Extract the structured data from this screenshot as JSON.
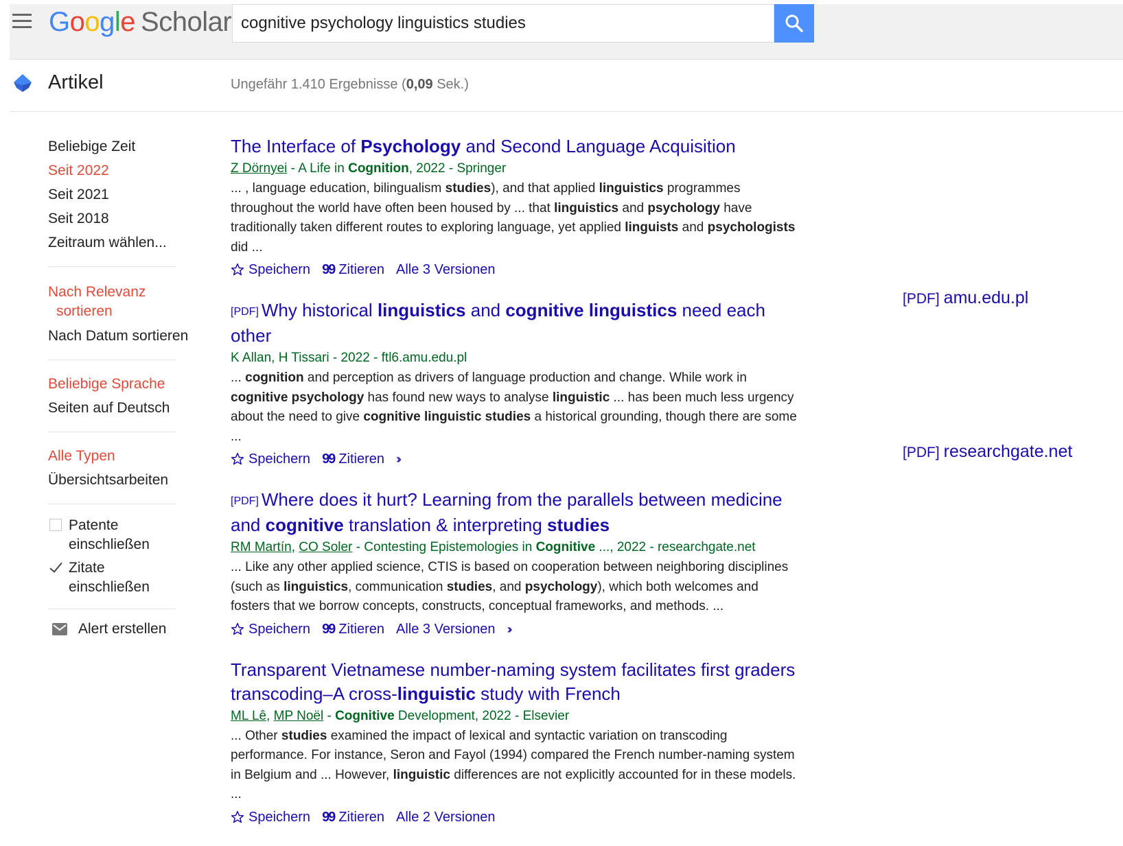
{
  "header": {
    "logo_google": [
      "G",
      "o",
      "o",
      "g",
      "l",
      "e"
    ],
    "logo_scholar": "Scholar",
    "search_value": "cognitive psychology linguistics studies"
  },
  "subbar": {
    "section_label": "Artikel",
    "stats_prefix": "Ungefähr 1.410 Ergebnisse (",
    "stats_time": "0,09",
    "stats_suffix": " Sek.)"
  },
  "sidebar": {
    "time": [
      "Beliebige Zeit",
      "Seit 2022",
      "Seit 2021",
      "Seit 2018",
      "Zeitraum wählen..."
    ],
    "sort_relevance_1": "Nach Relevanz",
    "sort_relevance_2": "sortieren",
    "sort_date": "Nach Datum sortieren",
    "lang_any": "Beliebige Sprache",
    "lang_de": "Seiten auf Deutsch",
    "type_all": "Alle Typen",
    "type_review": "Übersichtsarbeiten",
    "patents_1": "Patente",
    "patents_2": "einschließen",
    "citations": "Zitate einschließen",
    "alert": "Alert erstellen"
  },
  "actions": {
    "save": "Speichern",
    "cite": "Zitieren"
  },
  "results": [
    {
      "title": [
        {
          "t": "The Interface of "
        },
        {
          "b": "Psychology"
        },
        {
          "t": " and Second Language Acquisition"
        }
      ],
      "meta": [
        {
          "u": "Z Dörnyei"
        },
        {
          "t": " - A Life in "
        },
        {
          "b": "Cognition"
        },
        {
          "t": ", 2022 - Springer"
        }
      ],
      "snippet": [
        {
          "t": "... , language education, bilingualism "
        },
        {
          "b": "studies"
        },
        {
          "t": "), and that applied "
        },
        {
          "b": "linguistics"
        },
        {
          "t": " programmes throughout the world have often been housed by ... that "
        },
        {
          "b": "linguistics"
        },
        {
          "t": " and "
        },
        {
          "b": "psychology"
        },
        {
          "t": " have traditionally taken different routes to exploring language, yet applied "
        },
        {
          "b": "linguists"
        },
        {
          "t": " and "
        },
        {
          "b": "psychologists"
        },
        {
          "t": " did ..."
        }
      ],
      "versions": "Alle 3 Versionen",
      "more": false
    },
    {
      "tag": "[PDF]",
      "title": [
        {
          "t": "Why historical "
        },
        {
          "b": "linguistics"
        },
        {
          "t": " and "
        },
        {
          "b": "cognitive linguistics"
        },
        {
          "t": " need each other"
        }
      ],
      "meta": [
        {
          "t": "K Allan, H Tissari - 2022 - ftl6.amu.edu.pl"
        }
      ],
      "snippet": [
        {
          "t": "... "
        },
        {
          "b": "cognition"
        },
        {
          "t": " and perception as drivers of language production and change. While work in "
        },
        {
          "b": "cognitive psychology"
        },
        {
          "t": " has found new ways to analyse "
        },
        {
          "b": "linguistic"
        },
        {
          "t": " ... has been much less urgency about the need to give "
        },
        {
          "b": "cognitive linguistic studies"
        },
        {
          "t": " a historical grounding, though there are some ..."
        }
      ],
      "versions": "",
      "more": true
    },
    {
      "tag": "[PDF]",
      "title": [
        {
          "t": "Where does it hurt? Learning from the parallels between medicine and "
        },
        {
          "b": "cognitive"
        },
        {
          "t": " translation & interpreting "
        },
        {
          "b": "studies"
        }
      ],
      "meta": [
        {
          "u": "RM Martín"
        },
        {
          "t": ", "
        },
        {
          "u": "CO Soler"
        },
        {
          "t": " - Contesting Epistemologies in "
        },
        {
          "b": "Cognitive"
        },
        {
          "t": " ..., 2022 - researchgate.net"
        }
      ],
      "snippet": [
        {
          "t": "... Like any other applied science, CTIS is based on cooperation between neighboring disciplines (such as "
        },
        {
          "b": "linguistics"
        },
        {
          "t": ", communication "
        },
        {
          "b": "studies"
        },
        {
          "t": ", and "
        },
        {
          "b": "psychology"
        },
        {
          "t": "), which both welcomes and fosters that we borrow concepts, constructs, conceptual frameworks, and methods. ..."
        }
      ],
      "versions": "Alle 3 Versionen",
      "more": true
    },
    {
      "title": [
        {
          "t": "Transparent Vietnamese number-naming system facilitates first graders transcoding–A cross-"
        },
        {
          "b": "linguistic"
        },
        {
          "t": " study with French"
        }
      ],
      "meta": [
        {
          "u": "ML Lê"
        },
        {
          "t": ", "
        },
        {
          "u": "MP Noël"
        },
        {
          "t": " - "
        },
        {
          "b": "Cognitive"
        },
        {
          "t": " Development, 2022 - Elsevier"
        }
      ],
      "snippet": [
        {
          "t": "... Other "
        },
        {
          "b": "studies"
        },
        {
          "t": " examined the impact of lexical and syntactic variation on transcoding performance. For instance, Seron and Fayol (1994) compared the French number-naming system in Belgium and ... However, "
        },
        {
          "b": "linguistic"
        },
        {
          "t": " differences are not explicitly accounted for in these models. ..."
        }
      ],
      "versions": "Alle 2 Versionen",
      "more": false
    }
  ],
  "side_links": [
    {
      "tag": "[PDF]",
      "domain": "amu.edu.pl"
    },
    {
      "tag": "[PDF]",
      "domain": "researchgate.net"
    }
  ]
}
